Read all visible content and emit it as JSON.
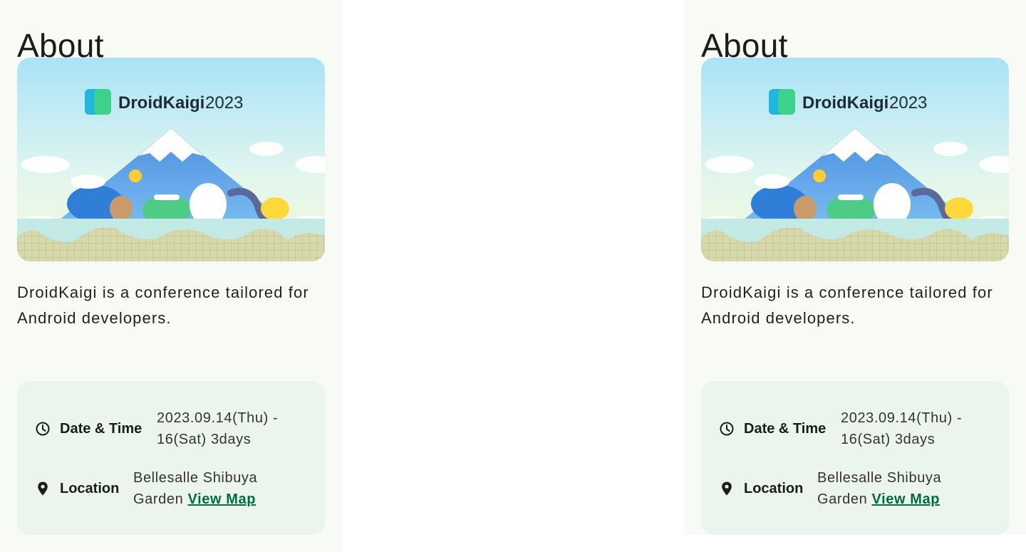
{
  "panels": [
    {
      "title": "About",
      "banner": {
        "logo_text": "DroidKaigi",
        "logo_year": "2023"
      },
      "description": "DroidKaigi is a conference tailored for Android developers.",
      "date_label": "Date & Time",
      "date_line1": "2023.09.14(Thu) -",
      "date_line2": "16(Sat) 3days",
      "location_label": "Location",
      "location_line1": "Bellesalle Shibuya",
      "location_line2": "Garden",
      "map_link": "View Map"
    },
    {
      "title": "About",
      "banner": {
        "logo_text": "DroidKaigi",
        "logo_year": "2023"
      },
      "description": "DroidKaigi is a conference tailored for Android developers.",
      "date_label": "Date & Time",
      "date_line1": "2023.09.14(Thu) -",
      "date_line2": "16(Sat) 3days",
      "location_label": "Location",
      "location_line1": "Bellesalle Shibuya",
      "location_line2": "Garden",
      "map_link": "View Map"
    }
  ],
  "colors": {
    "panel_bg": "#f8fbf5",
    "info_bg": "#ecf5ed",
    "link": "#006c47"
  }
}
